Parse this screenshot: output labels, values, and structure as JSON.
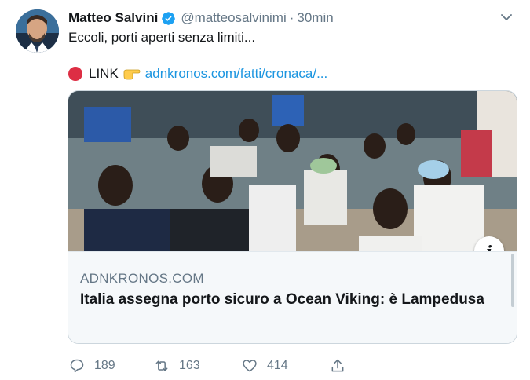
{
  "tweet": {
    "author": {
      "name": "Matteo Salvini",
      "handle": "@matteosalvinimi",
      "verified": true
    },
    "separator": "·",
    "time": "30min",
    "text_line1": "Eccoli, porti aperti senza limiti...",
    "link_label": "LINK",
    "link_url": "adnkronos.com/fatti/cronaca/...",
    "card": {
      "domain": "ADNKRONOS.COM",
      "title": "Italia assegna porto sicuro a Ocean Viking: è Lampedusa",
      "info_icon": "info-icon"
    },
    "actions": {
      "replies": "189",
      "retweets": "163",
      "likes": "414"
    }
  },
  "colors": {
    "accent": "#1da1f2",
    "link": "#1b95e0",
    "muted": "#657786",
    "red_circle": "#dd2e44"
  }
}
